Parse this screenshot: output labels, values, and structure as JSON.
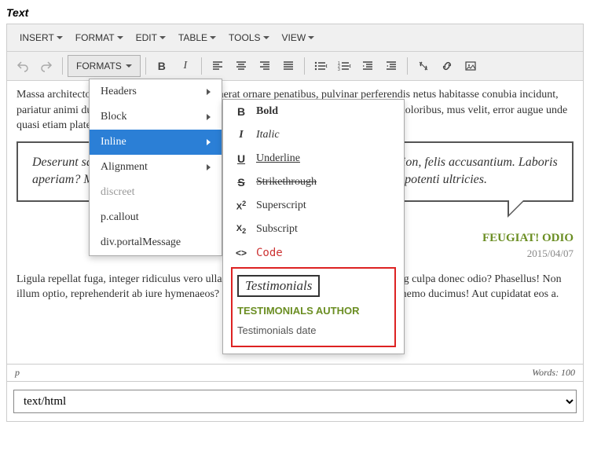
{
  "field_label": "Text",
  "menubar": {
    "insert": "INSERT",
    "format": "FORMAT",
    "edit": "EDIT",
    "table": "TABLE",
    "tools": "TOOLS",
    "view": "VIEW"
  },
  "toolbar": {
    "formats_label": "FORMATS"
  },
  "dropdown": {
    "headers": "Headers",
    "block": "Block",
    "inline": "Inline",
    "alignment": "Alignment",
    "discreet": "discreet",
    "pcallout": "p.callout",
    "divportal": "div.portalMessage"
  },
  "inline_sub": {
    "bold": "Bold",
    "italic": "Italic",
    "underline": "Underline",
    "strike": "Strikethrough",
    "superscript": "Superscript",
    "subscript": "Subscript",
    "code": "Code",
    "testimonials": "Testimonials",
    "testimonials_author": "TESTIMONIALS AUTHOR",
    "testimonials_date": "Testimonials date"
  },
  "content": {
    "p1": "Massa architecto ligula tortor id, vitae mus quaerat ornare penatibus, pulvinar perferendis netus habitasse conubia incidunt, pariatur animi dui est pede nullam dolor, veritatis volutpat, molestie excepturi, facilisi, doloribus, mus velit, error augue unde quasi etiam platea. Vel aliquam incidunt ac!",
    "quote": "Deserunt sapiente! Ducimus nostrum molestias senectus etiam? Exercitation, felis accusantium. Laboris aperiam? Maecenas suscipit? Dictumst enim, quaerat nonummy vehicula potenti ultricies.",
    "author": "FEUGIAT! ODIO",
    "date": "2015/04/07",
    "p2": "Ligula repellat fuga, integer ridiculus vero ullamcorper morbi proident risus? Adipisicing culpa donec odio? Phasellus! Non illum optio, reprehenderit ab iure hymenaeos? Nesciunt dolor, facere nostrum dictumst nemo ducimus! Aut cupidatat eos a."
  },
  "statusbar": {
    "path": "p",
    "words_label": "Words:",
    "words_count": "100"
  },
  "mime": "text/html"
}
